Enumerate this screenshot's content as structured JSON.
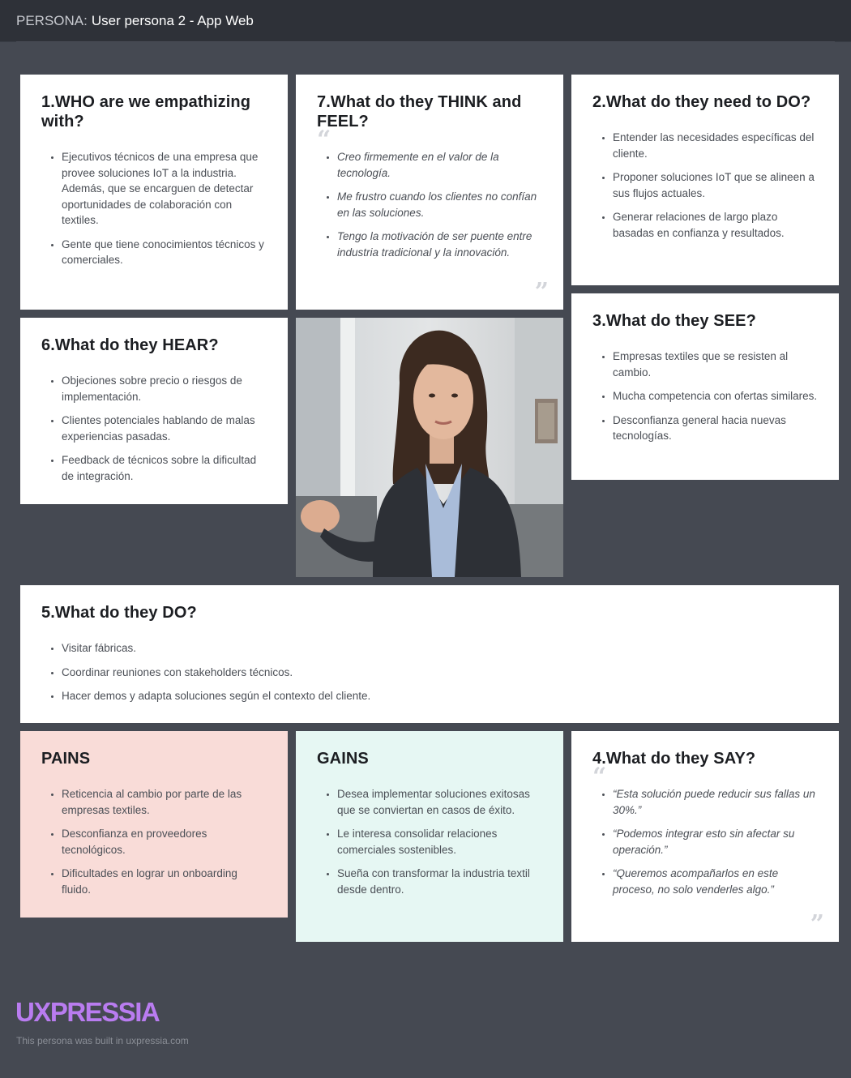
{
  "header": {
    "prefix": "PERSONA:",
    "title": "User persona 2 - App Web"
  },
  "colors": {
    "background": "#454952",
    "header_bg": "#2e3138",
    "card_bg": "#ffffff",
    "pains_bg": "#f9dcd8",
    "gains_bg": "#e6f7f3",
    "brand": "#b97cf0"
  },
  "cards": {
    "who": {
      "title": "1.WHO are we empathizing with?",
      "items": [
        "Ejecutivos técnicos de una empresa que provee soluciones IoT a la industria. Además, que se encarguen de detectar oportunidades de colaboración con textiles.",
        "Gente que tiene conocimientos técnicos y comerciales."
      ]
    },
    "think": {
      "title": "7.What do they THINK and FEEL?",
      "items": [
        "Creo firmemente en el valor de la tecnología.",
        "Me frustro cuando los clientes no confían en las soluciones.",
        "Tengo la motivación de ser puente entre industria tradicional y la innovación."
      ]
    },
    "need": {
      "title": "2.What do they need to DO?",
      "items": [
        "Entender las necesidades específicas del cliente.",
        "Proponer soluciones IoT que se alineen a sus flujos actuales.",
        "Generar relaciones de largo plazo basadas en confianza y resultados."
      ]
    },
    "hear": {
      "title": "6.What do they HEAR?",
      "items": [
        "Objeciones sobre precio o riesgos de implementación.",
        "Clientes potenciales hablando de malas experiencias pasadas.",
        "Feedback de técnicos sobre la dificultad de integración."
      ]
    },
    "see": {
      "title": "3.What do they SEE?",
      "items": [
        "Empresas textiles que se resisten al cambio.",
        "Mucha competencia con ofertas similares.",
        "Desconfianza general hacia nuevas tecnologías."
      ]
    },
    "do": {
      "title": "5.What do they DO?",
      "items": [
        "Visitar fábricas.",
        "Coordinar reuniones con stakeholders técnicos.",
        "Hacer demos y adapta soluciones según el contexto del cliente."
      ]
    },
    "pains": {
      "title": "PAINS",
      "items": [
        "Reticencia al cambio por parte de las empresas textiles.",
        "Desconfianza en proveedores tecnológicos.",
        "Dificultades en lograr un onboarding fluido."
      ]
    },
    "gains": {
      "title": "GAINS",
      "items": [
        "Desea implementar soluciones exitosas que se conviertan en casos de éxito.",
        "Le interesa consolidar relaciones comerciales sostenibles.",
        "Sueña con transformar la industria textil desde dentro."
      ]
    },
    "say": {
      "title": "4.What do they SAY?",
      "items": [
        "“Esta solución puede reducir sus fallas un 30%.”",
        "“Podemos integrar esto sin afectar su operación.”",
        "“Queremos acompañarlos en este proceso, no solo venderles algo.”"
      ]
    }
  },
  "quote_marks": {
    "open": "“",
    "close": "”"
  },
  "footer": {
    "logo": "UXPRESSIA",
    "note": "This persona was built in uxpressia.com"
  }
}
